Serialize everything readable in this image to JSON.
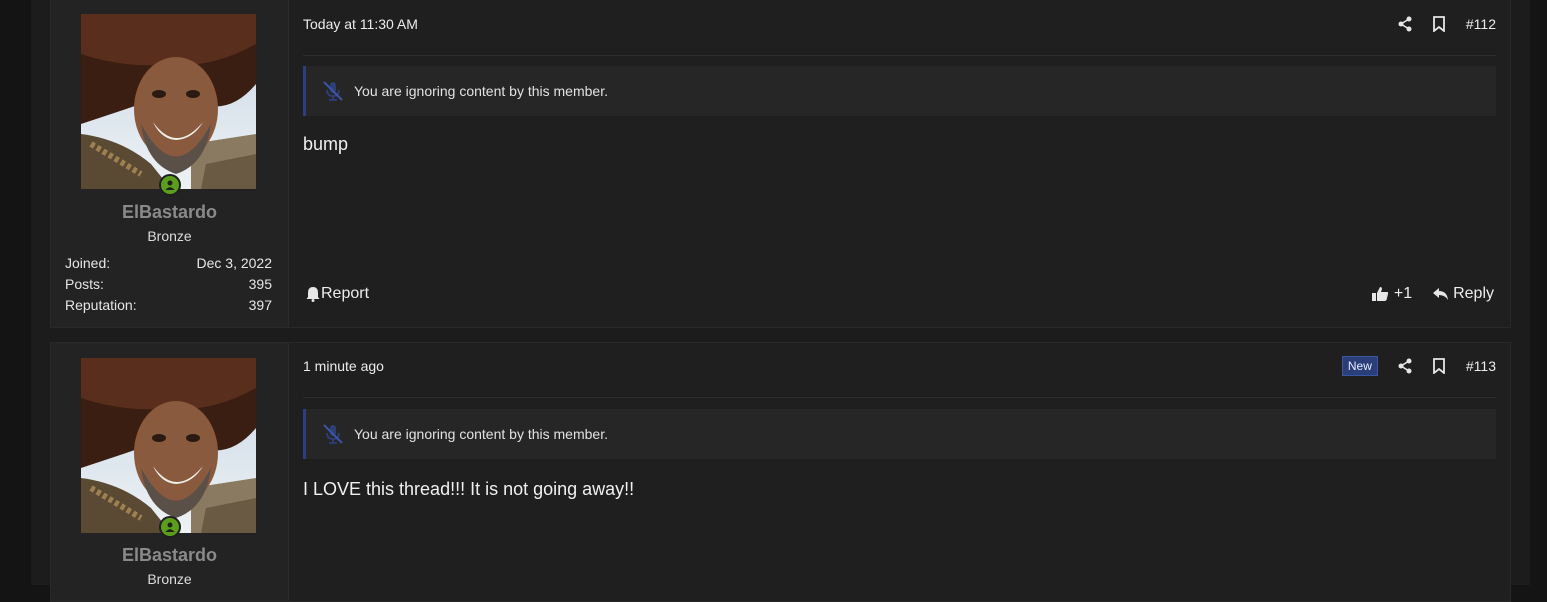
{
  "posts": [
    {
      "username": "ElBastardo",
      "user_title": "Bronze",
      "stats": [
        {
          "label": "Joined:",
          "value": "Dec 3, 2022"
        },
        {
          "label": "Posts:",
          "value": "395"
        },
        {
          "label": "Reputation:",
          "value": "397"
        }
      ],
      "date": "Today at 11:30 AM",
      "post_number": "#112",
      "ignored_notice": "You are ignoring content by this member.",
      "body": "bump",
      "report_label": "Report",
      "reaction_count": "+1",
      "reply_label": "Reply"
    },
    {
      "username": "ElBastardo",
      "user_title": "Bronze",
      "date": "1 minute ago",
      "new_badge": "New",
      "post_number": "#113",
      "ignored_notice": "You are ignoring content by this member.",
      "body": "I LOVE this thread!!! It is not going away!!"
    }
  ],
  "colors": {
    "page_bg": "#141414",
    "post_bg": "#1f1f1f",
    "username": "#8a8a8a",
    "online": "#5a9e1c",
    "accent": "#2d3e78"
  }
}
